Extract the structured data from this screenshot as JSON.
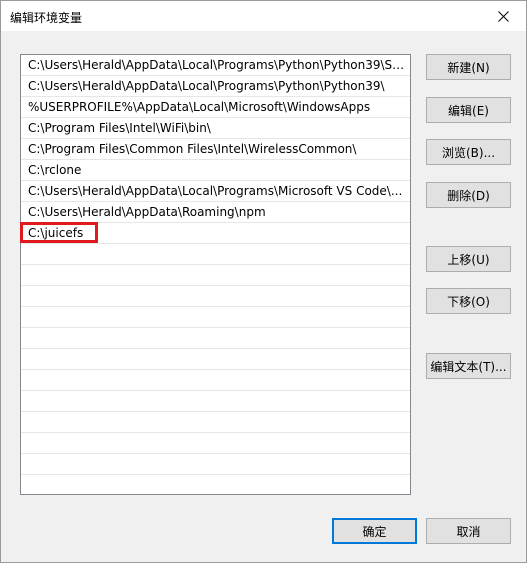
{
  "window": {
    "title": "编辑环境变量"
  },
  "list": {
    "items": [
      "C:\\Users\\Herald\\AppData\\Local\\Programs\\Python\\Python39\\Scr...",
      "C:\\Users\\Herald\\AppData\\Local\\Programs\\Python\\Python39\\",
      "%USERPROFILE%\\AppData\\Local\\Microsoft\\WindowsApps",
      "C:\\Program Files\\Intel\\WiFi\\bin\\",
      "C:\\Program Files\\Common Files\\Intel\\WirelessCommon\\",
      "C:\\rclone",
      "C:\\Users\\Herald\\AppData\\Local\\Programs\\Microsoft VS Code\\...",
      "C:\\Users\\Herald\\AppData\\Roaming\\npm",
      "C:\\juicefs",
      "",
      "",
      "",
      "",
      "",
      "",
      "",
      "",
      "",
      "",
      "",
      ""
    ]
  },
  "buttons": {
    "new": "新建(N)",
    "edit": "编辑(E)",
    "browse": "浏览(B)...",
    "delete": "删除(D)",
    "move_up": "上移(U)",
    "move_down": "下移(O)",
    "edit_text": "编辑文本(T)...",
    "ok": "确定",
    "cancel": "取消"
  },
  "highlight": {
    "color": "#e0191e"
  }
}
